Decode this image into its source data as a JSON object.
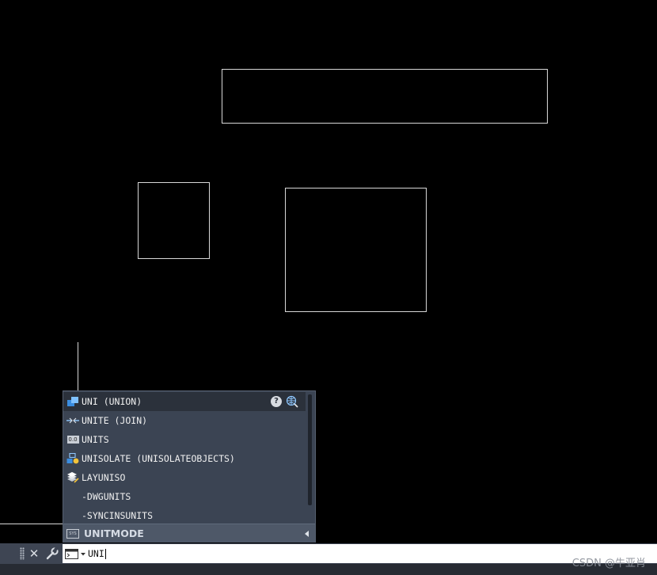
{
  "autocomplete": {
    "items": [
      {
        "label": "UNI (UNION)",
        "icon": "union-solid-icon"
      },
      {
        "label": "UNITE (JOIN)",
        "icon": "join-icon"
      },
      {
        "label": "UNITS",
        "icon": "units-icon",
        "icon_text": "0.0"
      },
      {
        "label": "UNISOLATE (UNISOLATEOBJECTS)",
        "icon": "unisolate-objects-icon"
      },
      {
        "label": "LAYUNISO",
        "icon": "layer-uniso-icon"
      },
      {
        "label": "-DWGUNITS",
        "icon": ""
      },
      {
        "label": "-SYNCINSUNITS",
        "icon": ""
      }
    ],
    "footer_label": "UNITMODE",
    "footer_icon_text": "SYS",
    "help_glyph": "?"
  },
  "command_line": {
    "close_glyph": "✕",
    "input_value": "UNI"
  },
  "watermark": "CSDN @牛亚肖",
  "colors": {
    "canvas": "#000000",
    "popup": "#3b4453",
    "selected_row": "#2b313b",
    "cmdbar": "#3e4553",
    "geometry_line": "#d8d8d8"
  }
}
